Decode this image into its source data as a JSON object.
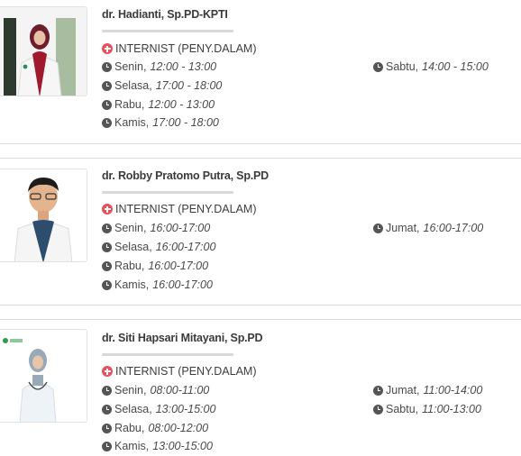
{
  "doctors": [
    {
      "name": "dr. Hadianti, Sp.PD-KPTI",
      "specialty": "INTERNIST (PENY.DALAM)",
      "schedule_left": [
        {
          "day": "Senin,",
          "time": "12:00 - 13:00"
        },
        {
          "day": "Selasa,",
          "time": "17:00 - 18:00"
        },
        {
          "day": "Rabu,",
          "time": "12:00 - 13:00"
        },
        {
          "day": "Kamis,",
          "time": "17:00 - 18:00"
        }
      ],
      "schedule_right": [
        {
          "day": "Sabtu,",
          "time": "14:00 - 15:00"
        }
      ]
    },
    {
      "name": "dr. Robby Pratomo Putra, Sp.PD",
      "specialty": "INTERNIST (PENY.DALAM)",
      "schedule_left": [
        {
          "day": "Senin,",
          "time": "16:00-17:00"
        },
        {
          "day": "Selasa,",
          "time": "16:00-17:00"
        },
        {
          "day": "Rabu,",
          "time": "16:00-17:00"
        },
        {
          "day": "Kamis,",
          "time": "16:00-17:00"
        }
      ],
      "schedule_right": [
        {
          "day": "Jumat,",
          "time": "16:00-17:00"
        }
      ]
    },
    {
      "name": "dr. Siti Hapsari Mitayani, Sp.PD",
      "specialty": "INTERNIST (PENY.DALAM)",
      "schedule_left": [
        {
          "day": "Senin,",
          "time": "08:00-11:00"
        },
        {
          "day": "Selasa,",
          "time": "13:00-15:00"
        },
        {
          "day": "Rabu,",
          "time": "08:00-12:00"
        },
        {
          "day": "Kamis,",
          "time": "13:00-15:00"
        }
      ],
      "schedule_right": [
        {
          "day": "Jumat,",
          "time": "11:00-14:00"
        },
        {
          "day": "Sabtu,",
          "time": "11:00-13:00"
        }
      ]
    }
  ],
  "colors": {
    "accent_red": "#e8505b",
    "clock_gray": "#555555",
    "text": "#3d3d3d"
  },
  "icons": {
    "specialty": "plus-circle-icon",
    "schedule": "clock-icon"
  }
}
